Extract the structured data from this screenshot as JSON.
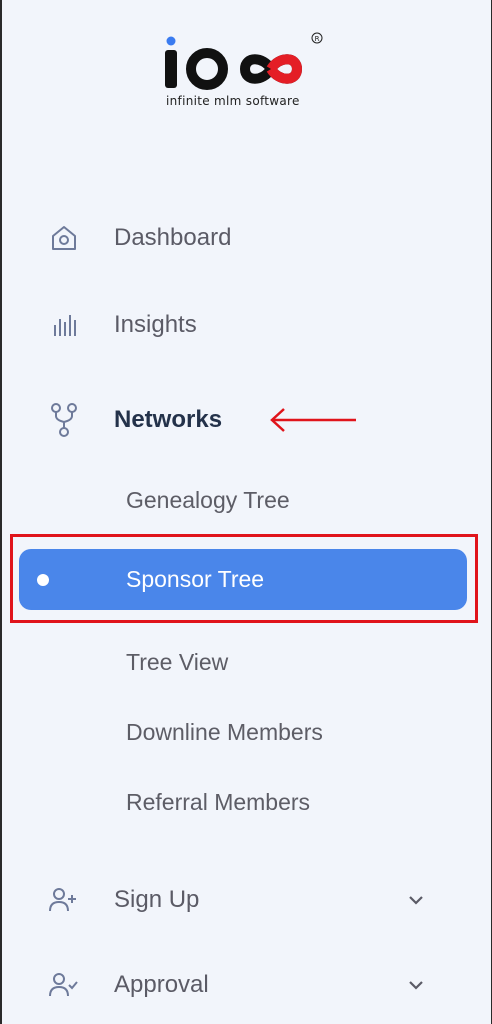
{
  "logo": {
    "wordmark": "ioo",
    "tagline": "infinite mlm software",
    "registered": "®"
  },
  "nav": {
    "dashboard": {
      "label": "Dashboard",
      "icon": "home-icon"
    },
    "insights": {
      "label": "Insights",
      "icon": "bar-chart-icon"
    },
    "networks": {
      "label": "Networks",
      "icon": "network-icon",
      "children": [
        {
          "label": "Genealogy Tree"
        },
        {
          "label": "Sponsor Tree",
          "selected": true
        },
        {
          "label": "Tree View"
        },
        {
          "label": "Downline Members"
        },
        {
          "label": "Referral Members"
        }
      ]
    },
    "signup": {
      "label": "Sign Up",
      "icon": "user-plus-icon",
      "chevron": "chevron-down-icon"
    },
    "approval": {
      "label": "Approval",
      "icon": "user-check-icon",
      "chevron": "chevron-down-icon"
    }
  },
  "colors": {
    "accent": "#4a86ea",
    "annotation": "#e0141b",
    "logo_red": "#e41e26"
  }
}
